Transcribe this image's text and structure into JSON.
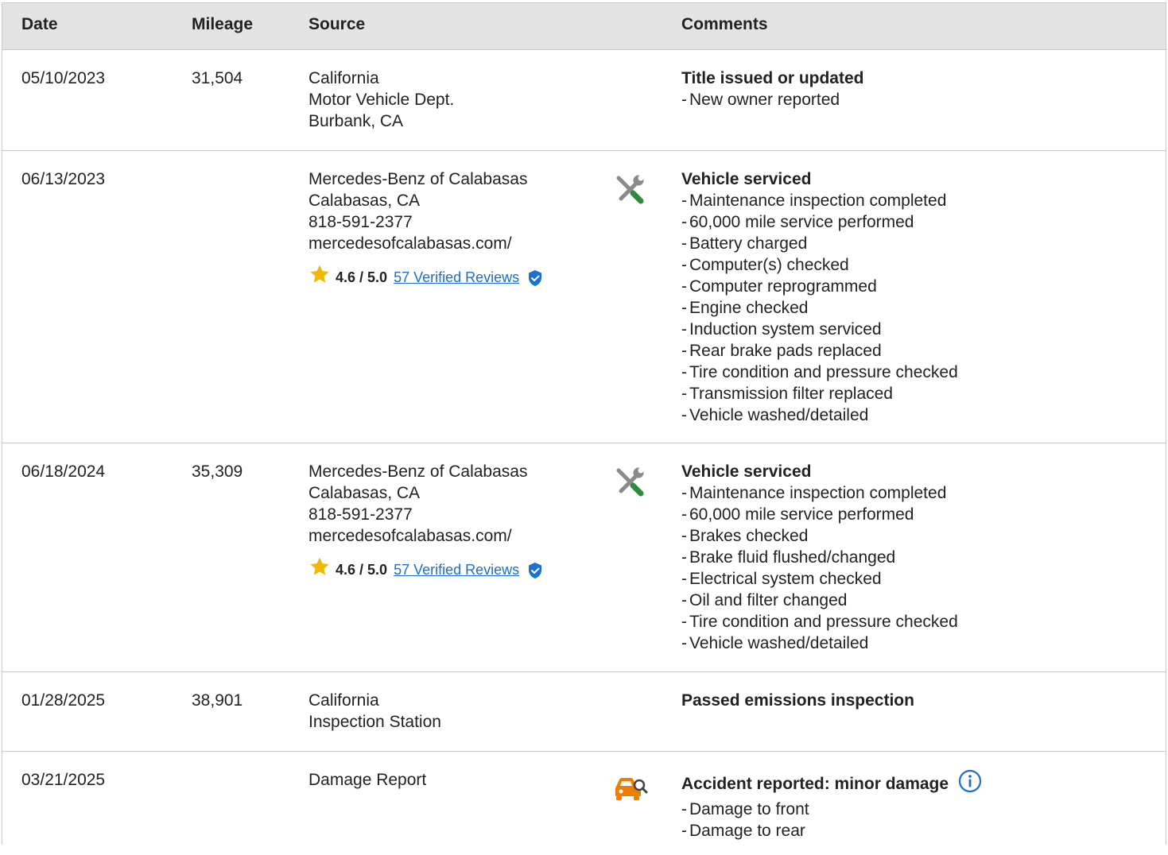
{
  "colors": {
    "header_bg": "#e4e4e4",
    "border": "#c9c9c9",
    "link": "#1a6fcf",
    "star": "#f5b800",
    "service_icon_green": "#2e8b3d",
    "service_icon_gray": "#8a8a8a",
    "damage_icon": "#f07c00"
  },
  "columns": {
    "date": "Date",
    "mileage": "Mileage",
    "source": "Source",
    "comments": "Comments"
  },
  "rows": [
    {
      "date": "05/10/2023",
      "mileage": "31,504",
      "source": [
        "California",
        "Motor Vehicle Dept.",
        "Burbank, CA"
      ],
      "icon": "",
      "comment_title": "Title issued or updated",
      "comment_items": [
        "New owner reported"
      ]
    },
    {
      "date": "06/13/2023",
      "mileage": "",
      "source": [
        "Mercedes-Benz of Calabasas",
        "Calabasas, CA",
        "818-591-2377",
        "mercedesofcalabasas.com/"
      ],
      "rating": {
        "score": "4.6 / 5.0",
        "reviews": "57 Verified Reviews"
      },
      "icon": "service-icon",
      "comment_title": "Vehicle serviced",
      "comment_items": [
        "Maintenance inspection completed",
        "60,000 mile service performed",
        "Battery charged",
        "Computer(s) checked",
        "Computer reprogrammed",
        "Engine checked",
        "Induction system serviced",
        "Rear brake pads replaced",
        "Tire condition and pressure checked",
        "Transmission filter replaced",
        "Vehicle washed/detailed"
      ]
    },
    {
      "date": "06/18/2024",
      "mileage": "35,309",
      "source": [
        "Mercedes-Benz of Calabasas",
        "Calabasas, CA",
        "818-591-2377",
        "mercedesofcalabasas.com/"
      ],
      "rating": {
        "score": "4.6 / 5.0",
        "reviews": "57 Verified Reviews"
      },
      "icon": "service-icon",
      "comment_title": "Vehicle serviced",
      "comment_items": [
        "Maintenance inspection completed",
        "60,000 mile service performed",
        "Brakes checked",
        "Brake fluid flushed/changed",
        "Electrical system checked",
        "Oil and filter changed",
        "Tire condition and pressure checked",
        "Vehicle washed/detailed"
      ]
    },
    {
      "date": "01/28/2025",
      "mileage": "38,901",
      "source": [
        "California",
        "Inspection Station"
      ],
      "icon": "",
      "comment_title": "Passed emissions inspection",
      "comment_items": []
    },
    {
      "date": "03/21/2025",
      "mileage": "",
      "source": [
        "Damage Report"
      ],
      "icon": "damage-icon",
      "comment_title": "Accident reported: minor damage",
      "comment_items": [
        "Damage to front",
        "Damage to rear"
      ]
    }
  ]
}
